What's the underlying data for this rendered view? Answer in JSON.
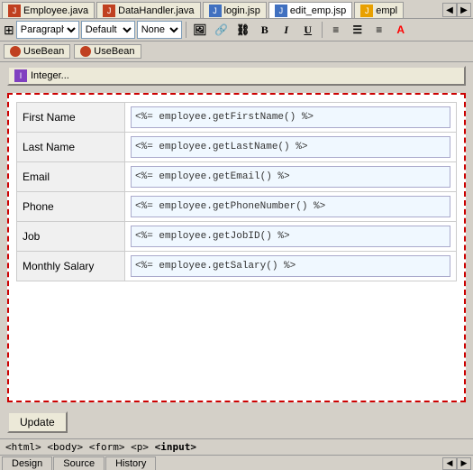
{
  "tabs": [
    {
      "id": "employee-java",
      "label": "Employee.java",
      "icon": "java",
      "active": false
    },
    {
      "id": "datahandler-java",
      "label": "DataHandler.java",
      "icon": "java",
      "active": false
    },
    {
      "id": "login-jsp",
      "label": "login.jsp",
      "icon": "jsp",
      "active": false
    },
    {
      "id": "edit-emp-jsp",
      "label": "edit_emp.jsp",
      "icon": "jsp",
      "active": true
    },
    {
      "id": "empl-tab",
      "label": "empl",
      "icon": "jsp",
      "active": false
    }
  ],
  "toolbar": {
    "paragraph_label": "Paragraph",
    "default_label": "Default",
    "none_label": "None",
    "bold": "B",
    "italic": "I",
    "underline": "U"
  },
  "beans": [
    {
      "label": "UseBean"
    },
    {
      "label": "UseBean"
    }
  ],
  "integer_button": "Integer...",
  "form": {
    "fields": [
      {
        "label": "First Name",
        "value": "<%= employee.getFirstName() %>"
      },
      {
        "label": "Last Name",
        "value": "<%= employee.getLastName() %>"
      },
      {
        "label": "Email",
        "value": "<%= employee.getEmail() %>"
      },
      {
        "label": "Phone",
        "value": "<%= employee.getPhoneNumber() %>"
      },
      {
        "label": "Job",
        "value": "<%= employee.getJobID() %>"
      },
      {
        "label": "Monthly Salary",
        "value": "<%= employee.getSalary() %>"
      }
    ]
  },
  "update_button": "Update",
  "status_bar": {
    "path": "<html> <body> <form> <p> ",
    "bold_part": "<input>"
  },
  "bottom_tabs": [
    {
      "label": "Design",
      "active": false
    },
    {
      "label": "Source",
      "active": false
    },
    {
      "label": "History",
      "active": false
    }
  ]
}
